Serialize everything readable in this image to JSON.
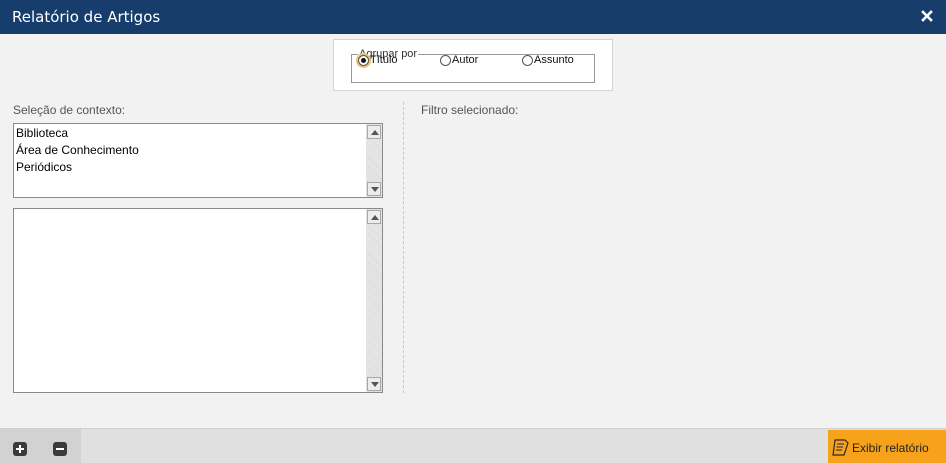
{
  "window": {
    "title": "Relatório de Artigos",
    "close_icon": "close-icon"
  },
  "group_by": {
    "legend": "Agrupar por",
    "options": [
      {
        "label": "Título",
        "checked": true
      },
      {
        "label": "Autor",
        "checked": false
      },
      {
        "label": "Assunto",
        "checked": false
      }
    ]
  },
  "context": {
    "label": "Seleção de contexto:",
    "items": [
      "Biblioteca",
      "Área de Conhecimento",
      "Periódicos"
    ]
  },
  "filter": {
    "label": "Filtro selecionado:"
  },
  "footer": {
    "add_icon": "plus-icon",
    "remove_icon": "minus-icon",
    "report_button": "Exibir relatório",
    "report_icon": "report-icon",
    "accent": "#f7a21b"
  },
  "colors": {
    "titlebar": "#163d6b",
    "background": "#f2f2f2"
  }
}
